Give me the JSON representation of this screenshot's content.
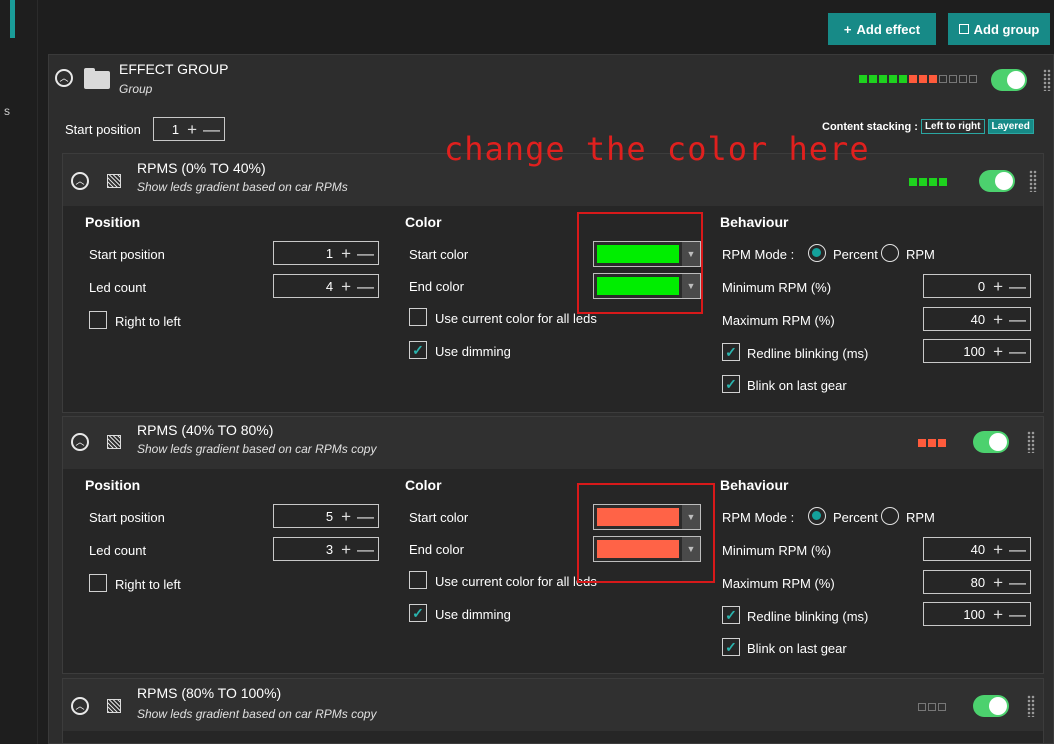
{
  "topbar": {
    "add_effect": "Add effect",
    "add_group": "Add group",
    "colors": {
      "accent": "#178a87"
    }
  },
  "left": {
    "cut_text": "s"
  },
  "group": {
    "title": "EFFECT GROUP",
    "subtitle": "Group",
    "leds": [
      "#1ed21e",
      "#1ed21e",
      "#1ed21e",
      "#1ed21e",
      "#1ed21e",
      "#ff5b3c",
      "#ff5b3c",
      "#ff5b3c",
      "off",
      "off",
      "off",
      "off"
    ],
    "enabled": true,
    "start_position_label": "Start position",
    "start_position_value": "1",
    "content_stacking_label": "Content stacking :",
    "stacking_options": [
      "Left to right",
      "Layered"
    ],
    "stacking_selected": "Layered"
  },
  "annotation": "change the color here",
  "labels": {
    "position": "Position",
    "color": "Color",
    "behaviour": "Behaviour",
    "start_position": "Start position",
    "led_count": "Led count",
    "right_to_left": "Right to left",
    "start_color": "Start color",
    "end_color": "End color",
    "use_current_color": "Use current color for all leds",
    "use_dimming": "Use dimming",
    "rpm_mode": "RPM Mode :",
    "percent": "Percent",
    "rpm": "RPM",
    "minimum_rpm": "Minimum RPM (%)",
    "maximum_rpm": "Maximum RPM (%)",
    "redline_blinking": "Redline blinking (ms)",
    "blink_last_gear": "Blink on last gear"
  },
  "effects": [
    {
      "title": "RPMS (0% TO 40%)",
      "subtitle": "Show leds gradient based on car RPMs",
      "leds": [
        "#1ed21e",
        "#1ed21e",
        "#1ed21e",
        "#1ed21e"
      ],
      "start_position": "1",
      "led_count": "4",
      "right_to_left": false,
      "start_color": "#00ee00",
      "end_color": "#00ee00",
      "use_current_color": false,
      "use_dimming": true,
      "rpm_mode": "Percent",
      "minimum_rpm": "0",
      "maximum_rpm": "40",
      "redline_blinking_enabled": true,
      "redline_blinking": "100",
      "blink_last_gear": true
    },
    {
      "title": "RPMS (40% TO 80%)",
      "subtitle": "Show leds gradient based on car RPMs copy",
      "leds": [
        "#ff5b3c",
        "#ff5b3c",
        "#ff5b3c"
      ],
      "start_position": "5",
      "led_count": "3",
      "right_to_left": false,
      "start_color": "#ff6347",
      "end_color": "#ff6347",
      "use_current_color": false,
      "use_dimming": true,
      "rpm_mode": "Percent",
      "minimum_rpm": "40",
      "maximum_rpm": "80",
      "redline_blinking_enabled": true,
      "redline_blinking": "100",
      "blink_last_gear": true
    },
    {
      "title": "RPMS (80% TO 100%)",
      "subtitle": "Show leds gradient based on car RPMs copy",
      "leds": [
        "off",
        "off",
        "off"
      ]
    }
  ]
}
